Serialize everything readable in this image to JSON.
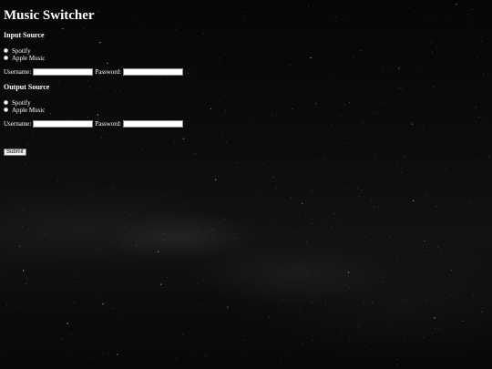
{
  "page": {
    "title": "Music Switcher"
  },
  "input_source": {
    "heading": "Input Source",
    "options": [
      "Spotify",
      "Apple Music"
    ],
    "username_label": "Username:",
    "password_label": "Password:",
    "username_value": "",
    "password_value": ""
  },
  "output_source": {
    "heading": "Output Source",
    "options": [
      "Spotify",
      "Apple Music"
    ],
    "username_label": "Username:",
    "password_label": "Password:",
    "username_value": "",
    "password_value": ""
  },
  "form": {
    "submit_label": "Submit"
  },
  "colors": {
    "background": "#0a0a0a",
    "text": "#ffffff"
  }
}
